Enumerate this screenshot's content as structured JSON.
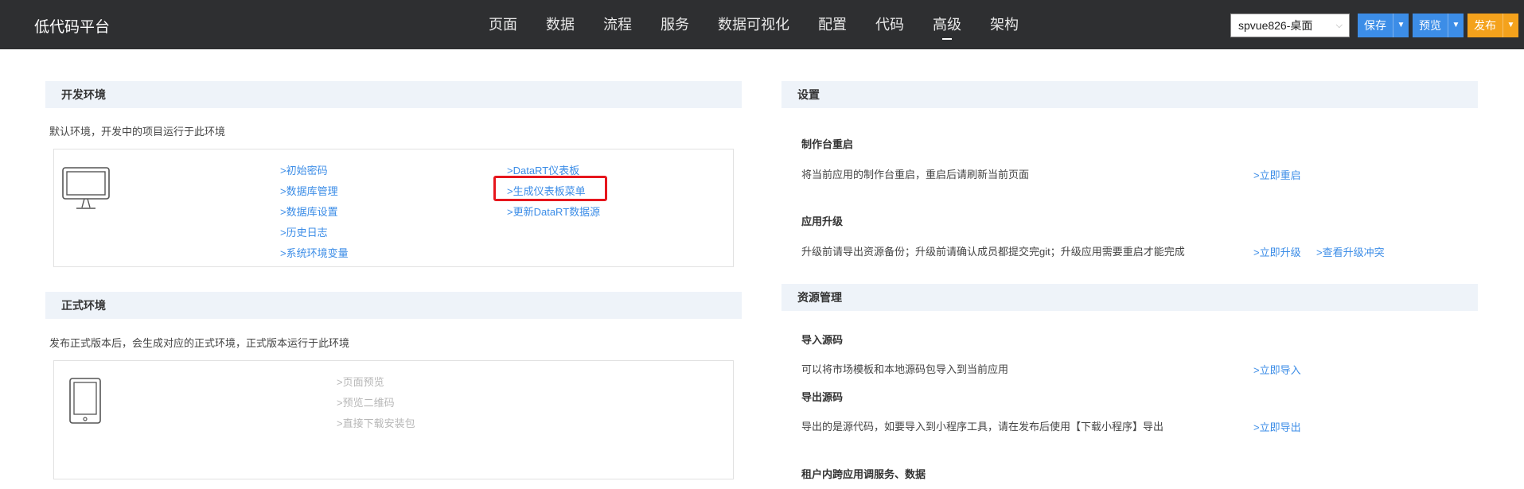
{
  "header": {
    "brand": "低代码平台",
    "nav": [
      "页面",
      "数据",
      "流程",
      "服务",
      "数据可视化",
      "配置",
      "代码",
      "高级",
      "架构"
    ],
    "active_nav": "高级",
    "project_select": "spvue826-桌面",
    "buttons": {
      "save": "保存",
      "preview": "预览",
      "publish": "发布"
    },
    "colors": {
      "bar": "#2e2f31",
      "blue": "#3c8de7",
      "orange": "#f4a21c"
    }
  },
  "dev_env": {
    "title": "开发环境",
    "desc": "默认环境，开发中的项目运行于此环境",
    "icon": "monitor-icon",
    "links_col1": [
      ">初始密码",
      ">数据库管理",
      ">数据库设置",
      ">历史日志",
      ">系统环境变量"
    ],
    "links_col2": [
      ">DataRT仪表板",
      ">生成仪表板菜单",
      ">更新DataRT数据源"
    ],
    "highlighted": ">生成仪表板菜单"
  },
  "prod_env": {
    "title": "正式环境",
    "desc": "发布正式版本后，会生成对应的正式环境，正式版本运行于此环境",
    "icon": "tablet-icon",
    "links": [
      ">页面预览",
      ">预览二维码",
      ">直接下载安装包"
    ]
  },
  "settings": {
    "title": "设置",
    "restart": {
      "title": "制作台重启",
      "desc": "将当前应用的制作台重启，重启后请刷新当前页面",
      "link": ">立即重启"
    },
    "upgrade": {
      "title": "应用升级",
      "desc": "升级前请导出资源备份；升级前请确认成员都提交完git；升级应用需要重启才能完成",
      "link1": ">立即升级",
      "link2": ">查看升级冲突"
    }
  },
  "resources": {
    "title": "资源管理",
    "import": {
      "title": "导入源码",
      "desc": "可以将市场模板和本地源码包导入到当前应用",
      "link": ">立即导入"
    },
    "export": {
      "title": "导出源码",
      "desc": "导出的是源代码，如要导入到小程序工具，请在发布后使用【下载小程序】导出",
      "link": ">立即导出"
    },
    "tenant": {
      "title": "租户内跨应用调服务、数据"
    }
  }
}
